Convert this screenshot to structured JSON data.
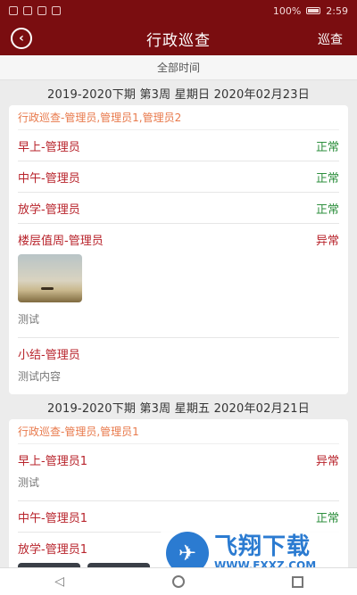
{
  "status_bar": {
    "battery": "100%",
    "time": "2:59"
  },
  "app_bar": {
    "title": "行政巡查",
    "action": "巡查"
  },
  "filter": {
    "label": "全部时间"
  },
  "sections": [
    {
      "date": "2019-2020下期 第3周 星期日 2020年02月23日",
      "category": "行政巡查-管理员,管理员1,管理员2",
      "rows": [
        {
          "title": "早上-管理员",
          "status": "正常"
        },
        {
          "title": "中午-管理员",
          "status": "正常"
        },
        {
          "title": "放学-管理员",
          "status": "正常"
        },
        {
          "title": "楼层值周-管理员",
          "status": "异常",
          "note": "测试"
        },
        {
          "title": "小结-管理员",
          "note": "测试内容"
        }
      ]
    },
    {
      "date": "2019-2020下期 第3周 星期五 2020年02月21日",
      "category": "行政巡查-管理员,管理员1",
      "rows": [
        {
          "title": "早上-管理员1",
          "status": "异常",
          "note": "测试"
        },
        {
          "title": "中午-管理员1",
          "status": "正常"
        },
        {
          "title": "放学-管理员1"
        }
      ]
    }
  ],
  "watermark": {
    "title": "飞翔下载",
    "url": "WWW.FXXZ.COM"
  },
  "colors": {
    "primary": "#7a0d10",
    "ok": "#2e8f3e",
    "abnormal": "#b8232b",
    "category": "#e8794b"
  },
  "icons": {
    "back": "back-arrow-circle-icon",
    "nav_back": "triangle-back-icon",
    "nav_home": "circle-home-icon",
    "nav_recent": "square-recent-icon"
  }
}
